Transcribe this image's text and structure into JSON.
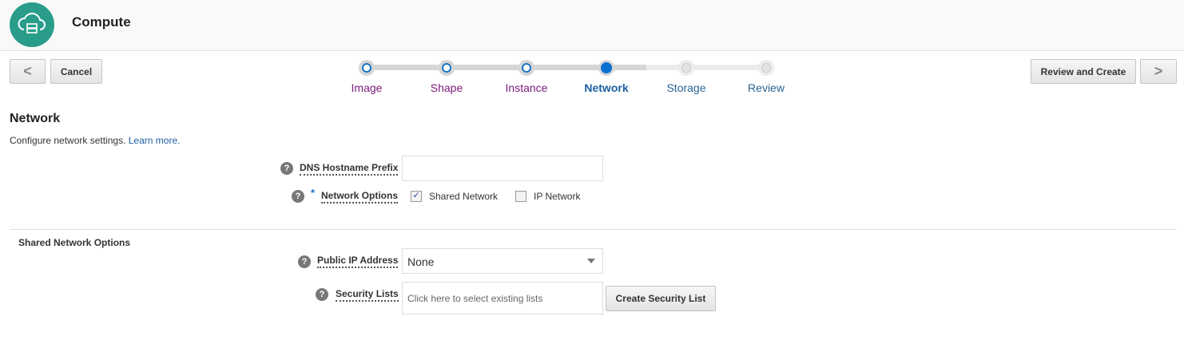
{
  "header": {
    "title": "Compute",
    "icon": "cloud-server-icon"
  },
  "nav": {
    "back": "<",
    "cancel": "Cancel",
    "review_create": "Review and Create",
    "next": ">"
  },
  "train": {
    "steps": [
      {
        "label": "Image",
        "state": "visited"
      },
      {
        "label": "Shape",
        "state": "visited"
      },
      {
        "label": "Instance",
        "state": "visited"
      },
      {
        "label": "Network",
        "state": "current"
      },
      {
        "label": "Storage",
        "state": "unvisited"
      },
      {
        "label": "Review",
        "state": "unvisited"
      }
    ]
  },
  "section": {
    "title": "Network",
    "desc": "Configure network settings.",
    "learn_more": "Learn more."
  },
  "form": {
    "dns_label": "DNS Hostname Prefix",
    "dns_value": "",
    "required_mark": "*",
    "network_options_label": "Network Options",
    "shared_network": "Shared Network",
    "shared_checked": true,
    "ip_network": "IP Network",
    "ip_checked": false,
    "help": "?"
  },
  "shared": {
    "title": "Shared Network Options",
    "public_ip_label": "Public IP Address",
    "public_ip_value": "None",
    "security_lists_label": "Security Lists",
    "security_placeholder": "Click here to select existing lists",
    "create_security_list": "Create Security List"
  }
}
